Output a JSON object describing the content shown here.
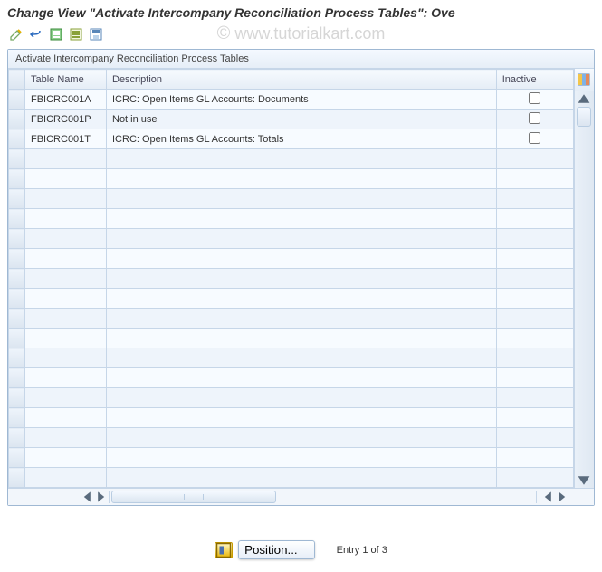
{
  "title": "Change View \"Activate Intercompany Reconciliation Process Tables\": Ove",
  "watermark": "www.tutorialkart.com",
  "panel_title": "Activate Intercompany Reconciliation Process Tables",
  "columns": {
    "name": "Table Name",
    "desc": "Description",
    "inactive": "Inactive"
  },
  "rows": [
    {
      "name": "FBICRC001A",
      "desc": "ICRC: Open Items GL Accounts: Documents",
      "inactive": false
    },
    {
      "name": "FBICRC001P",
      "desc": "Not in use",
      "inactive": false
    },
    {
      "name": "FBICRC001T",
      "desc": "ICRC: Open Items GL Accounts: Totals",
      "inactive": false
    }
  ],
  "empty_rows": 17,
  "footer": {
    "position_label": "Position...",
    "entry_label": "Entry 1 of 3"
  },
  "colors": {
    "border": "#9fb8d3",
    "header_bg": "#e5edf6"
  },
  "chart_data": {
    "type": "table",
    "columns": [
      "Table Name",
      "Description",
      "Inactive"
    ],
    "rows": [
      [
        "FBICRC001A",
        "ICRC: Open Items GL Accounts: Documents",
        false
      ],
      [
        "FBICRC001P",
        "Not in use",
        false
      ],
      [
        "FBICRC001T",
        "ICRC: Open Items GL Accounts: Totals",
        false
      ]
    ]
  }
}
